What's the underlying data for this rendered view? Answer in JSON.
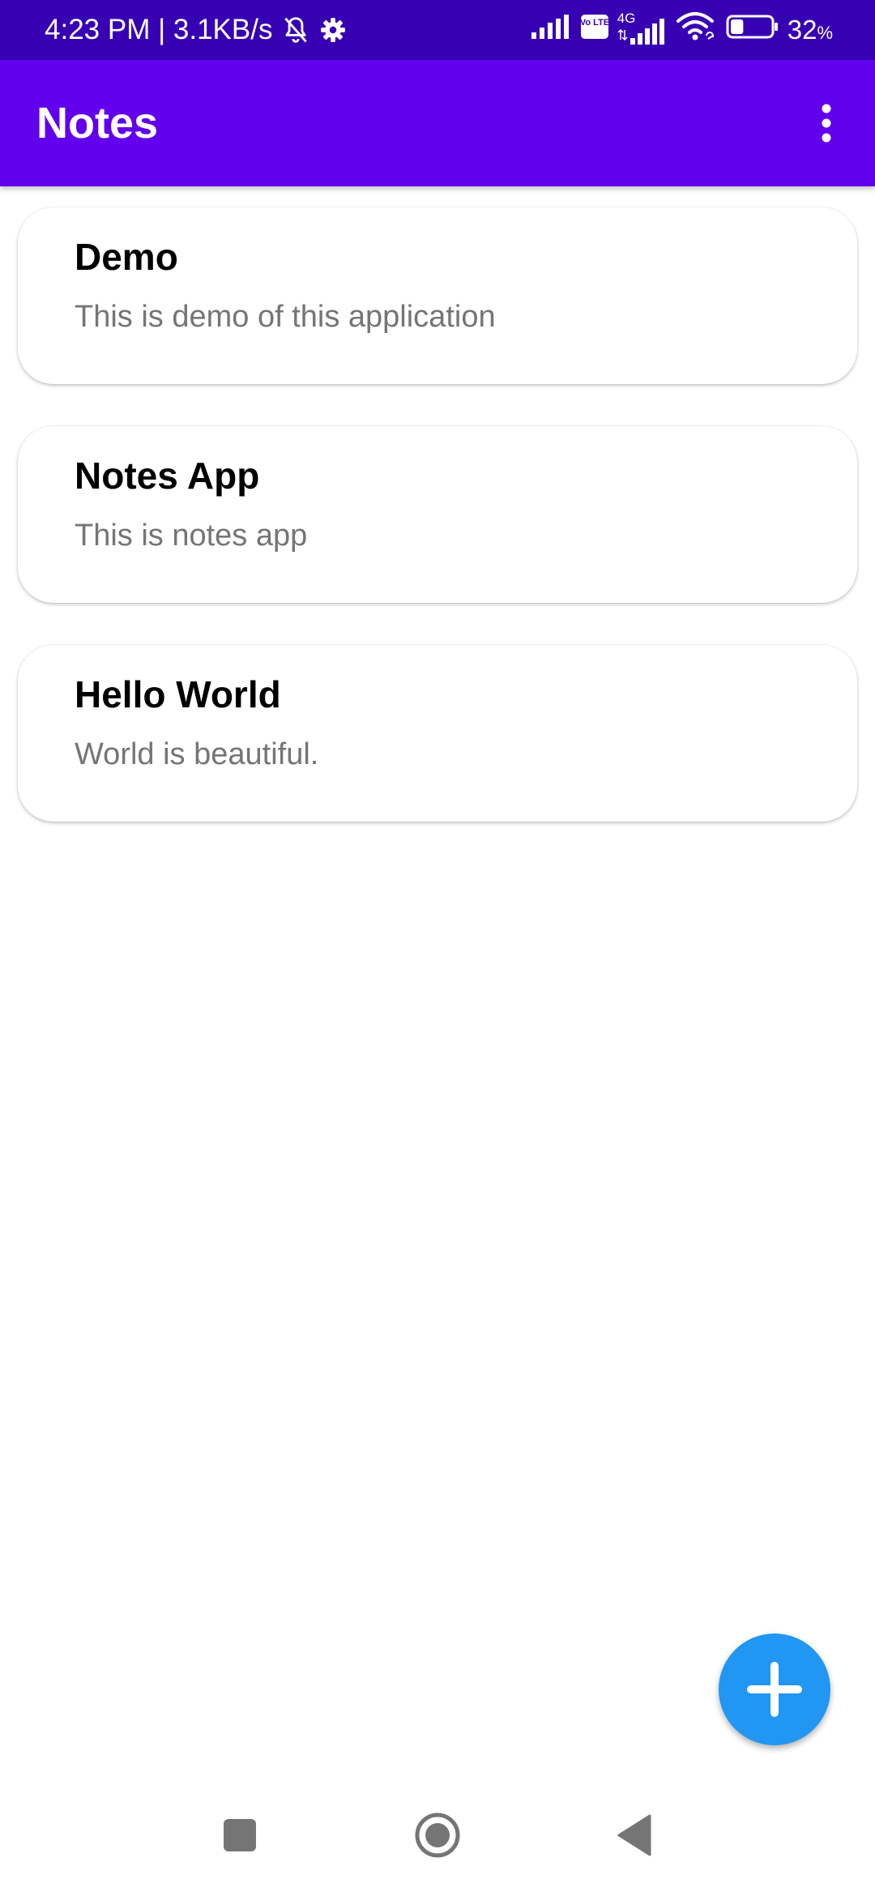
{
  "status_bar": {
    "time_speed": "4:23 PM | 3.1KB/s",
    "network_type": "4G",
    "volte_label": "Vo LTE",
    "battery_percent": "32",
    "battery_percent_sign": "%",
    "battery_level": 0.32,
    "icons": [
      "bell-off-icon",
      "gear-icon",
      "signal-icon",
      "volte-icon",
      "signal-4g-icon",
      "wifi-icon",
      "battery-icon"
    ]
  },
  "app_bar": {
    "title": "Notes",
    "menu_icon": "more-vert-icon"
  },
  "notes": [
    {
      "title": "Demo",
      "body": "This is demo of this application"
    },
    {
      "title": "Notes App",
      "body": "This is notes app"
    },
    {
      "title": "Hello World",
      "body": "World is beautiful."
    }
  ],
  "fab": {
    "icon": "plus-icon",
    "color": "#2196f3"
  },
  "nav_bar": {
    "icons": [
      "recents-square-icon",
      "home-circle-icon",
      "back-triangle-icon"
    ]
  },
  "colors": {
    "status_bar": "#3700b3",
    "app_bar": "#6200ee",
    "note_body_text": "#757575"
  }
}
